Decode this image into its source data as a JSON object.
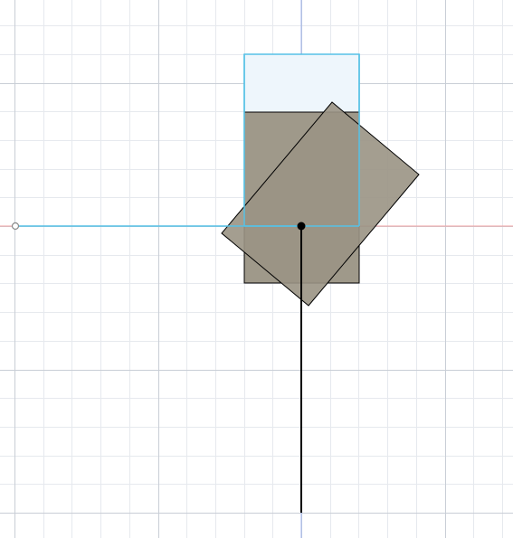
{
  "canvas": {
    "background_color": "#ffffff",
    "grid_minor_color": "#e6e9ee",
    "grid_major_color": "#c9ced6",
    "x_axis_color": "#f2a3a3",
    "y_axis_color": "#9db2ee"
  },
  "sketch": {
    "construction_line_color": "#56c1e6",
    "selected_fill_color": "#eef6fc",
    "selected_stroke_color": "#56c1e6",
    "solid_fill_color": "#9a9384",
    "edge_color": "#000000",
    "rotation_angle_deg": 40,
    "origin_point_color": "#000000",
    "endpoint_marker_color": "#8a8a8a"
  }
}
